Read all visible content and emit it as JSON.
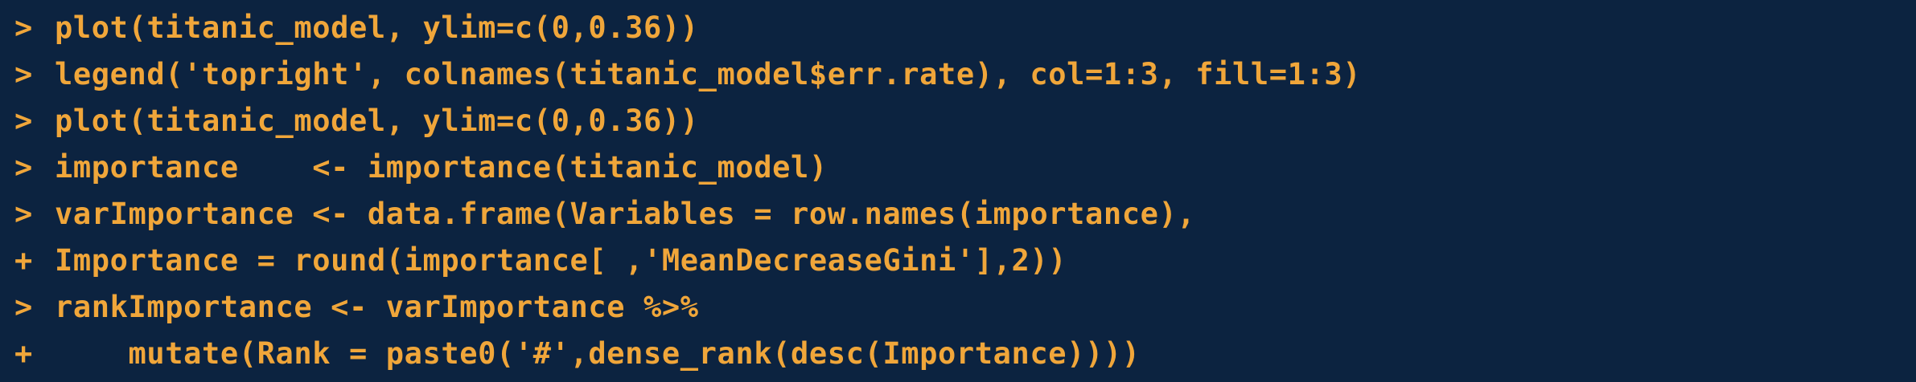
{
  "console": {
    "lines": [
      {
        "prompt": ">",
        "code": "plot(titanic_model, ylim=c(0,0.36))"
      },
      {
        "prompt": ">",
        "code": "legend('topright', colnames(titanic_model$err.rate), col=1:3, fill=1:3)"
      },
      {
        "prompt": ">",
        "code": "plot(titanic_model, ylim=c(0,0.36))"
      },
      {
        "prompt": ">",
        "code": "importance    <- importance(titanic_model)"
      },
      {
        "prompt": ">",
        "code": "varImportance <- data.frame(Variables = row.names(importance),"
      },
      {
        "prompt": "+",
        "code": "Importance = round(importance[ ,'MeanDecreaseGini'],2))"
      },
      {
        "prompt": ">",
        "code": "rankImportance <- varImportance %>%"
      },
      {
        "prompt": "+",
        "code": "    mutate(Rank = paste0('#',dense_rank(desc(Importance))))"
      }
    ]
  },
  "colors": {
    "background": "#0c2340",
    "text": "#f0a63a"
  }
}
